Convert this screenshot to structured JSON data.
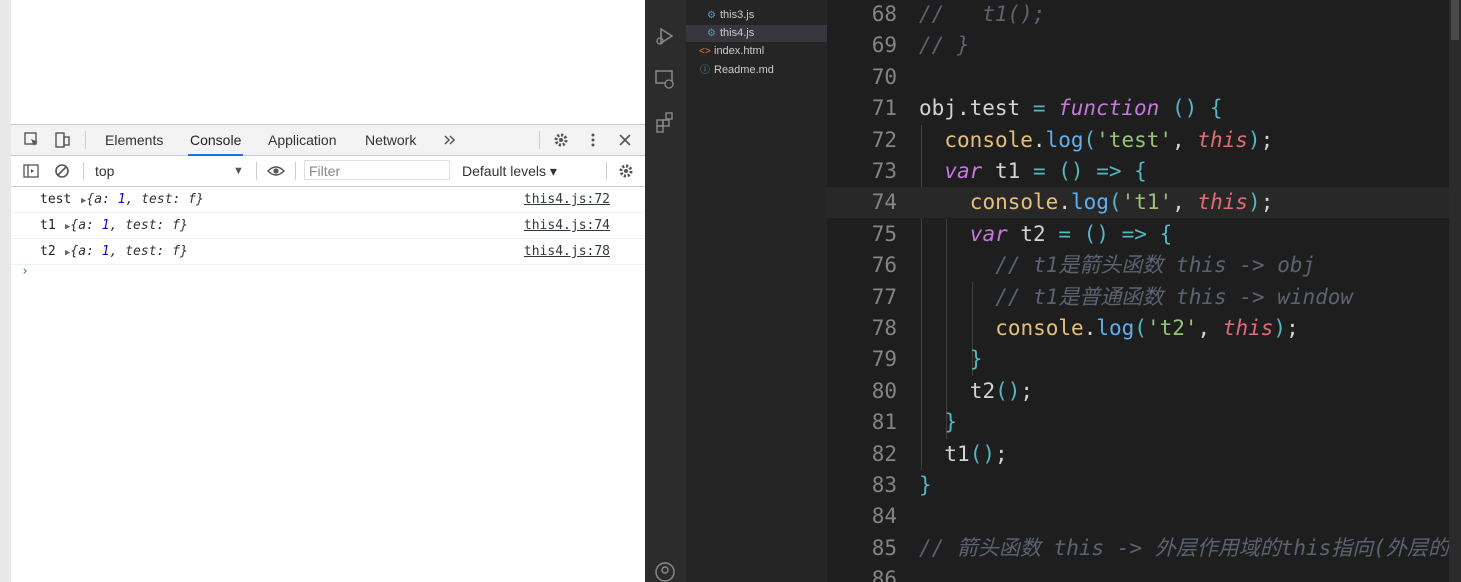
{
  "devtools": {
    "tabs": [
      "Elements",
      "Console",
      "Application",
      "Network"
    ],
    "active_tab": "Console",
    "more_tabs_icon": "chevron-double-right-icon",
    "context_selector": "top",
    "filter_placeholder": "Filter",
    "levels_label": "Default levels ▾",
    "messages": [
      {
        "label": "test",
        "obj_prefix": "{a: ",
        "num": "1",
        "obj_suffix": ", test: f}",
        "source": "this4.js:72"
      },
      {
        "label": "t1",
        "obj_prefix": "{a: ",
        "num": "1",
        "obj_suffix": ", test: f}",
        "source": "this4.js:74"
      },
      {
        "label": "t2",
        "obj_prefix": "{a: ",
        "num": "1",
        "obj_suffix": ", test: f}",
        "source": "this4.js:78"
      }
    ],
    "prompt": "›"
  },
  "explorer": {
    "files": [
      {
        "icon": "js-file-icon",
        "name": "this3.js"
      },
      {
        "icon": "js-file-icon",
        "name": "this4.js",
        "selected": true
      },
      {
        "icon": "html-file-icon",
        "name": "index.html"
      },
      {
        "icon": "info-file-icon",
        "name": "Readme.md"
      }
    ]
  },
  "editor": {
    "lines": [
      {
        "n": "68",
        "text": "//   t1();"
      },
      {
        "n": "69",
        "text": "// }"
      },
      {
        "n": "70",
        "text": ""
      },
      {
        "n": "71",
        "text": "obj.test = function () {"
      },
      {
        "n": "72",
        "text": "console.log('test', this);"
      },
      {
        "n": "73",
        "text": "var t1 = () => {"
      },
      {
        "n": "74",
        "text": "console.log('t1', this);"
      },
      {
        "n": "75",
        "text": "var t2 = () => {"
      },
      {
        "n": "76",
        "text": "// t1是箭头函数 this -> obj"
      },
      {
        "n": "77",
        "text": "// t1是普通函数 this -> window"
      },
      {
        "n": "78",
        "text": "console.log('t2', this);"
      },
      {
        "n": "79",
        "text": "}"
      },
      {
        "n": "80",
        "text": "t2();"
      },
      {
        "n": "81",
        "text": "}"
      },
      {
        "n": "82",
        "text": "t1();"
      },
      {
        "n": "83",
        "text": "}"
      },
      {
        "n": "84",
        "text": ""
      },
      {
        "n": "85",
        "text": "// 箭头函数 this -> 外层作用域的this指向(外层的"
      },
      {
        "n": "86",
        "text": ""
      }
    ]
  },
  "colors": {
    "keyword": "#c678dd",
    "this": "#e06c75",
    "string": "#98c379",
    "comment": "#5c6370",
    "method": "#61afef",
    "console": "#e5c07b",
    "devtools_accent": "#1a73e8"
  }
}
